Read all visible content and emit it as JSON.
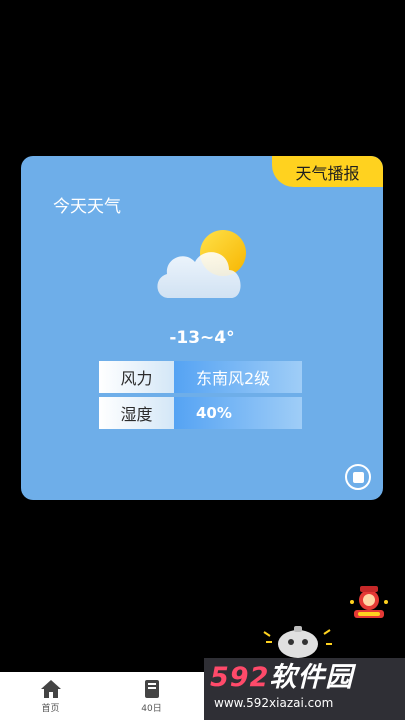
{
  "card": {
    "badge": "天气播报",
    "title": "今天天气",
    "weather_icon": "cloud-sun-icon",
    "temperature": "-13~4°",
    "rows": [
      {
        "label": "风力",
        "value": "东南风2级"
      },
      {
        "label": "湿度",
        "value": "40%"
      }
    ],
    "stop_icon": "stop-circle-icon"
  },
  "nav": {
    "items": [
      {
        "label": "首页",
        "icon": "home-icon"
      },
      {
        "label": "40日",
        "icon": "calendar-book-icon"
      }
    ]
  },
  "watermark": {
    "number": "592",
    "text": "软件园",
    "url": "www.592xiazai.com"
  },
  "colors": {
    "card_bg": "#6eaee9",
    "badge_bg": "#ffd21f",
    "page_bg": "#000000",
    "nav_bg": "#ffffff",
    "watermark_accent": "#ff4a6a"
  }
}
